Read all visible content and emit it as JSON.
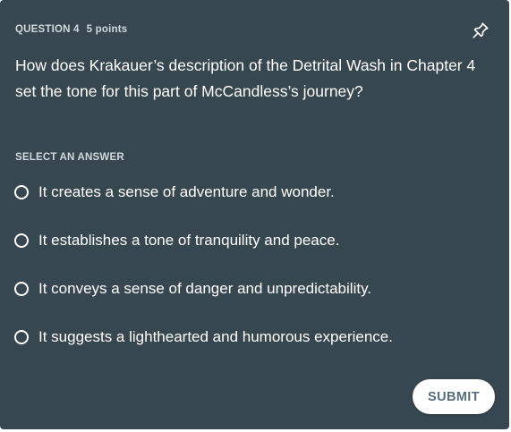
{
  "header": {
    "question_number": "QUESTION 4",
    "points": "5 points",
    "pin_icon": "pin-icon"
  },
  "question": {
    "text": "How does Krakauer’s description of the Detrital Wash in Chapter 4 set the tone for this part of McCandless’s journey?"
  },
  "answers": {
    "label": "SELECT AN ANSWER",
    "options": [
      {
        "text": "It creates a sense of adventure and wonder."
      },
      {
        "text": "It establishes a tone of tranquility and peace."
      },
      {
        "text": "It conveys a sense of danger and unpredictability."
      },
      {
        "text": "It suggests a lighthearted and humorous experience."
      }
    ]
  },
  "actions": {
    "submit_label": "SUBMIT"
  },
  "colors": {
    "card_background": "#37474f",
    "header_text": "#cfd8dc",
    "body_text": "#ffffff",
    "submit_background": "#ffffff",
    "submit_text": "#546e7a"
  }
}
